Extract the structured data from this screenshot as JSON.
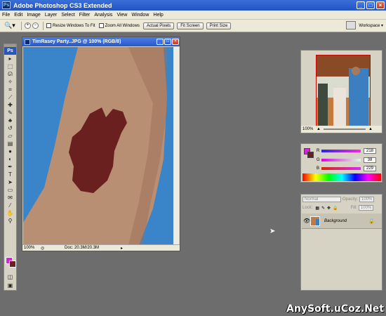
{
  "app": {
    "title": "Adobe Photoshop CS3 Extended",
    "logo": "Ps"
  },
  "window_buttons": {
    "minimize": "_",
    "maximize": "□",
    "close": "×"
  },
  "menu": [
    "File",
    "Edit",
    "Image",
    "Layer",
    "Select",
    "Filter",
    "Analysis",
    "View",
    "Window",
    "Help"
  ],
  "options": {
    "resize_windows_label": "Resize Windows To Fit",
    "zoom_all_label": "Zoom All Windows",
    "actual_pixels": "Actual Pixels",
    "fit_screen": "Fit Screen",
    "print_size": "Print Size",
    "workspace": "Workspace ▾"
  },
  "toolbox": {
    "badge": "Ps",
    "tools": [
      "zoom-icon",
      "move-icon",
      "marquee-icon",
      "lasso-icon",
      "magic-wand-icon",
      "crop-icon",
      "slice-icon",
      "healing-icon",
      "brush-icon",
      "clone-stamp-icon",
      "history-brush-icon",
      "eraser-icon",
      "gradient-icon",
      "blur-icon",
      "dodge-icon",
      "pen-icon",
      "type-icon",
      "path-select-icon",
      "shape-icon",
      "notes-icon",
      "eyedropper-icon",
      "hand-icon",
      "zoom-tool-icon"
    ]
  },
  "colors": {
    "foreground": "#d426d9",
    "background": "#6b2020",
    "paint": "#6b2020",
    "sky": "#3a84c9",
    "skin": "#b88f72"
  },
  "document": {
    "title": "TimRasey Party..JPG @ 100% (RGB/8)",
    "zoom": "100%",
    "doc_size": "Doc: 20.3M/20.3M"
  },
  "navigator": {
    "zoom": "100%"
  },
  "color_panel": {
    "channels": [
      {
        "label": "R",
        "value": "218"
      },
      {
        "label": "G",
        "value": "38"
      },
      {
        "label": "B",
        "value": "229"
      }
    ]
  },
  "layers": {
    "blend_mode": "Normal",
    "opacity_label": "Opacity:",
    "opacity": "100%",
    "lock_label": "Lock:",
    "fill_label": "Fill:",
    "fill": "100%",
    "layer_name": "Background"
  },
  "watermark": "AnySoft.uCoz.Net"
}
